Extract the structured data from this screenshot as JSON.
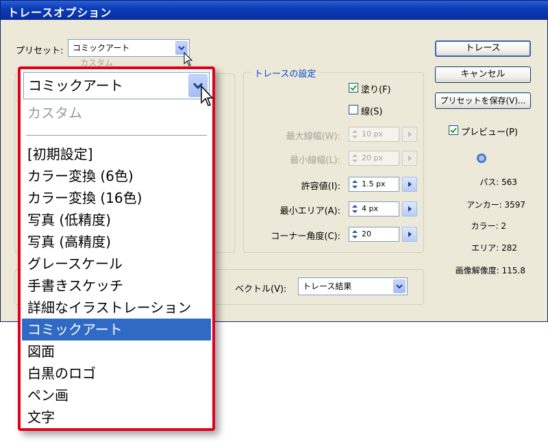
{
  "window": {
    "title": "トレースオプション"
  },
  "preset": {
    "label": "プリセット:",
    "value": "コミックアート",
    "ghost_item": "カスタム"
  },
  "buttons": {
    "trace": "トレース",
    "cancel": "キャンセル",
    "save_preset": "プリセットを保存(V)..."
  },
  "preview": {
    "label": "プレビュー(P)",
    "checked": true
  },
  "trace_settings": {
    "title": "トレースの設定",
    "fill": {
      "label": "塗り(F)",
      "checked": true
    },
    "stroke": {
      "label": "線(S)",
      "checked": false
    },
    "rows": [
      {
        "label": "最大線幅(W):",
        "value": "10 px",
        "disabled": true
      },
      {
        "label": "最小線幅(L):",
        "value": "20 px",
        "disabled": true
      },
      {
        "label": "許容値(I):",
        "value": "1.5 px",
        "disabled": false
      },
      {
        "label": "最小エリア(A):",
        "value": "4 px",
        "disabled": false
      },
      {
        "label": "コーナー角度(C):",
        "value": "20",
        "disabled": false
      }
    ]
  },
  "stats": {
    "paths": "パス: 563",
    "anchors": "アンカー: 3597",
    "colors": "カラー: 2",
    "areas": "エリア: 282",
    "resolution": "画像解像度: 115.8"
  },
  "vector": {
    "label": "ベクトル(V):",
    "value": "トレース結果"
  },
  "dropdown": {
    "value": "コミックアート",
    "items": [
      {
        "label": "カスタム",
        "state": "disabled"
      },
      {
        "label": "[初期設定]",
        "state": "normal"
      },
      {
        "label": "カラー変換 (6色)",
        "state": "normal"
      },
      {
        "label": "カラー変換 (16色)",
        "state": "normal"
      },
      {
        "label": "写真 (低精度)",
        "state": "normal"
      },
      {
        "label": "写真 (高精度)",
        "state": "normal"
      },
      {
        "label": "グレースケール",
        "state": "normal"
      },
      {
        "label": "手書きスケッチ",
        "state": "normal"
      },
      {
        "label": "詳細なイラストレーション",
        "state": "normal"
      },
      {
        "label": "コミックアート",
        "state": "selected"
      },
      {
        "label": "図面",
        "state": "normal"
      },
      {
        "label": "白黒のロゴ",
        "state": "normal"
      },
      {
        "label": "ペン画",
        "state": "normal"
      },
      {
        "label": "文字",
        "state": "normal"
      }
    ]
  },
  "colors": {
    "accent_red": "#e0001c",
    "selection_blue": "#316ac5",
    "titlebar_blue": "#0a3db8"
  }
}
